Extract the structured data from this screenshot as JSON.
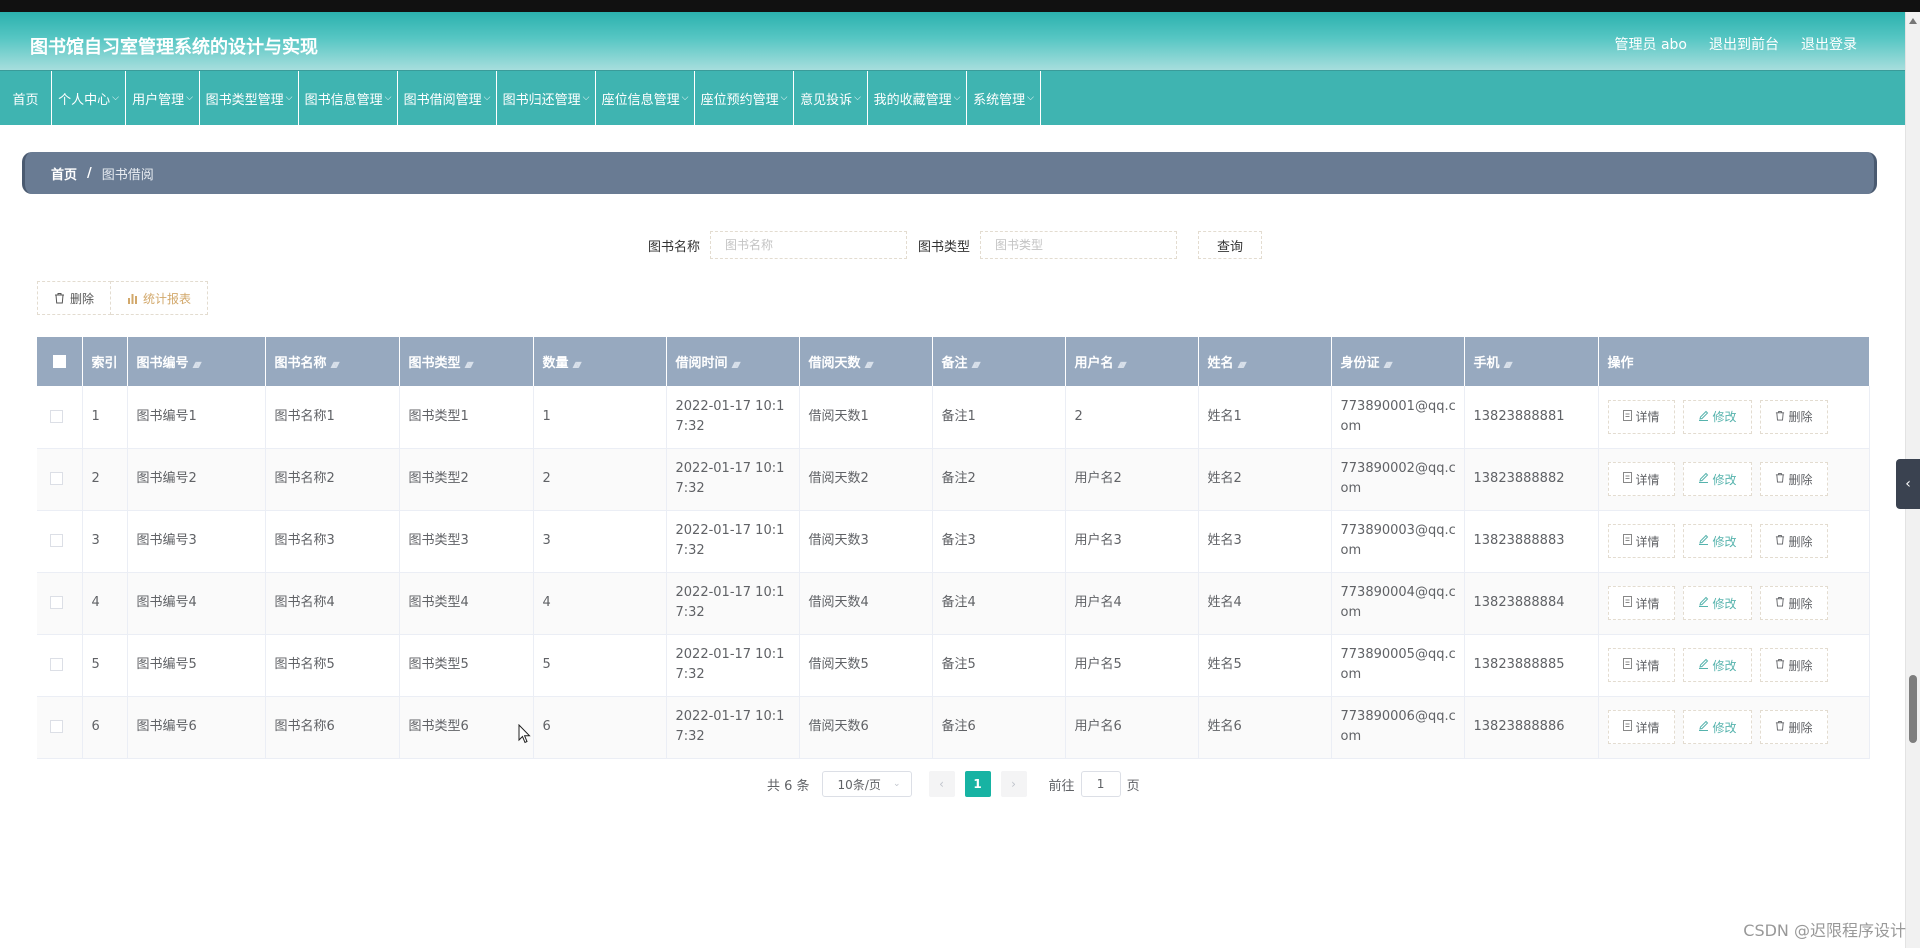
{
  "header": {
    "app_title": "图书馆自习室管理系统的设计与实现",
    "user_label": "管理员 abo",
    "to_front": "退出到前台",
    "logout": "退出登录"
  },
  "nav": [
    {
      "label": "首页",
      "chevron": false,
      "width": 52
    },
    {
      "label": "个人中心",
      "chevron": true,
      "width": 74
    },
    {
      "label": "用户管理",
      "chevron": true,
      "width": 74
    },
    {
      "label": "图书类型管理",
      "chevron": true,
      "width": 99
    },
    {
      "label": "图书信息管理",
      "chevron": true,
      "width": 99
    },
    {
      "label": "图书借阅管理",
      "chevron": true,
      "width": 99
    },
    {
      "label": "图书归还管理",
      "chevron": true,
      "width": 99
    },
    {
      "label": "座位信息管理",
      "chevron": true,
      "width": 99
    },
    {
      "label": "座位预约管理",
      "chevron": true,
      "width": 99
    },
    {
      "label": "意见投诉",
      "chevron": true,
      "width": 74
    },
    {
      "label": "我的收藏管理",
      "chevron": true,
      "width": 99
    },
    {
      "label": "系统管理",
      "chevron": true,
      "width": 74
    }
  ],
  "breadcrumb": {
    "home": "首页",
    "separator": "/",
    "current": "图书借阅"
  },
  "search": {
    "name_label": "图书名称",
    "name_placeholder": "图书名称",
    "type_label": "图书类型",
    "type_placeholder": "图书类型",
    "query_button": "查询"
  },
  "actions": {
    "delete": "删除",
    "report": "统计报表"
  },
  "table": {
    "columns": [
      "索引",
      "图书编号",
      "图书名称",
      "图书类型",
      "数量",
      "借阅时间",
      "借阅天数",
      "备注",
      "用户名",
      "姓名",
      "身份证",
      "手机",
      "操作"
    ],
    "sortable": [
      false,
      true,
      true,
      true,
      true,
      true,
      true,
      true,
      true,
      true,
      true,
      true,
      false
    ],
    "rows": [
      [
        "1",
        "图书编号1",
        "图书名称1",
        "图书类型1",
        "1",
        "2022-01-17 10:17:32",
        "借阅天数1",
        "备注1",
        "2",
        "姓名1",
        "773890001@qq.com",
        "13823888881"
      ],
      [
        "2",
        "图书编号2",
        "图书名称2",
        "图书类型2",
        "2",
        "2022-01-17 10:17:32",
        "借阅天数2",
        "备注2",
        "用户名2",
        "姓名2",
        "773890002@qq.com",
        "13823888882"
      ],
      [
        "3",
        "图书编号3",
        "图书名称3",
        "图书类型3",
        "3",
        "2022-01-17 10:17:32",
        "借阅天数3",
        "备注3",
        "用户名3",
        "姓名3",
        "773890003@qq.com",
        "13823888883"
      ],
      [
        "4",
        "图书编号4",
        "图书名称4",
        "图书类型4",
        "4",
        "2022-01-17 10:17:32",
        "借阅天数4",
        "备注4",
        "用户名4",
        "姓名4",
        "773890004@qq.com",
        "13823888884"
      ],
      [
        "5",
        "图书编号5",
        "图书名称5",
        "图书类型5",
        "5",
        "2022-01-17 10:17:32",
        "借阅天数5",
        "备注5",
        "用户名5",
        "姓名5",
        "773890005@qq.com",
        "13823888885"
      ],
      [
        "6",
        "图书编号6",
        "图书名称6",
        "图书类型6",
        "6",
        "2022-01-17 10:17:32",
        "借阅天数6",
        "备注6",
        "用户名6",
        "姓名6",
        "773890006@qq.com",
        "13823888886"
      ]
    ],
    "row_actions": {
      "detail": "详情",
      "edit": "修改",
      "delete": "删除"
    }
  },
  "pager": {
    "total": "共 6 条",
    "page_size": "10条/页",
    "current_page": "1",
    "goto_prefix": "前往",
    "goto_value": "1",
    "goto_suffix": "页"
  },
  "watermark": "CSDN @迟限程序设计",
  "colors": {
    "header_teal": "#2bb1ae",
    "nav_teal": "#3fb4b1",
    "breadcrumb_bg": "#697b93",
    "table_header_bg": "#97a9bf",
    "active_page": "#17b3a3",
    "edit_text": "#56b3ad",
    "report_text": "#d2a86b"
  },
  "icons": {
    "delete": "trash-icon",
    "report": "bar-chart-icon",
    "detail": "document-icon",
    "edit": "pencil-icon",
    "sort": "sort-caret-icon"
  }
}
